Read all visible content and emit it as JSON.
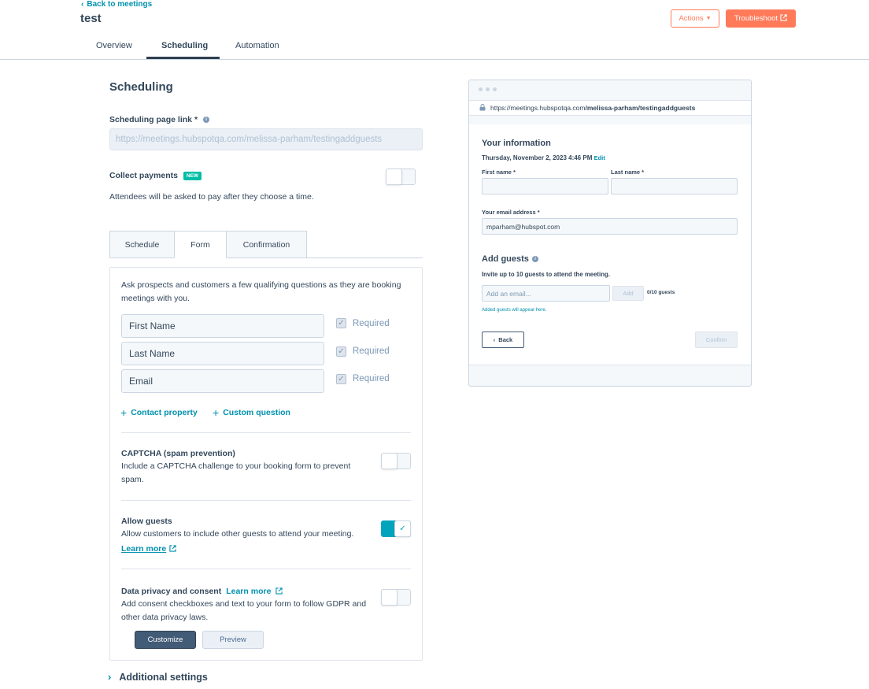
{
  "header": {
    "back_label": "Back to meetings",
    "title": "test",
    "actions_label": "Actions",
    "troubleshoot_label": "Troubleshoot",
    "tabs": [
      {
        "label": "Overview"
      },
      {
        "label": "Scheduling",
        "active": true
      },
      {
        "label": "Automation"
      }
    ]
  },
  "scheduling": {
    "title": "Scheduling",
    "page_link_label": "Scheduling page link",
    "required_marker": "*",
    "page_link_value": "https://meetings.hubspotqa.com/melissa-parham/testingaddguests",
    "collect_payments_label": "Collect payments",
    "new_badge": "NEW",
    "collect_payments_desc": "Attendees will be asked to pay after they choose a time.",
    "collect_payments_enabled": false
  },
  "inner_tabs": [
    {
      "label": "Schedule"
    },
    {
      "label": "Form",
      "active": true
    },
    {
      "label": "Confirmation"
    }
  ],
  "form": {
    "intro": "Ask prospects and customers a few qualifying questions as they are booking meetings with you.",
    "fields": [
      {
        "label": "First Name",
        "required_label": "Required",
        "required": true
      },
      {
        "label": "Last Name",
        "required_label": "Required",
        "required": true
      },
      {
        "label": "Email",
        "required_label": "Required",
        "required": true
      }
    ],
    "contact_property_label": "Contact property",
    "custom_question_label": "Custom question",
    "captcha": {
      "title": "CAPTCHA (spam prevention)",
      "desc": "Include a CAPTCHA challenge to your booking form to prevent spam.",
      "enabled": false
    },
    "guests": {
      "title": "Allow guests",
      "desc": "Allow customers to include other guests to attend your meeting.",
      "learn_more": "Learn more",
      "enabled": true
    },
    "privacy": {
      "title": "Data privacy and consent",
      "learn_more": "Learn more",
      "desc": "Add consent checkboxes and text to your form to follow GDPR and other data privacy laws.",
      "enabled": false,
      "customize_label": "Customize",
      "preview_label": "Preview"
    }
  },
  "additional_settings_label": "Additional settings",
  "preview": {
    "url_prefix": "https://meetings.hubspotqa.com",
    "url_path": "/melissa-parham/testingaddguests",
    "your_info_title": "Your information",
    "datetime": "Thursday, November 2, 2023 4:46 PM",
    "edit_label": "Edit",
    "first_name_label": "First name *",
    "last_name_label": "Last name *",
    "email_label": "Your email address *",
    "email_value": "mparham@hubspot.com",
    "add_guests_title": "Add guests",
    "invite_text": "Invite up to 10 guests to attend the meeting.",
    "add_email_placeholder": "Add an email...",
    "add_label": "Add",
    "guest_count": "0/10 guests",
    "added_note": "Added guests will appear here.",
    "back_label": "Back",
    "confirm_label": "Confirm"
  },
  "colors": {
    "accent": "#ff7a59",
    "link": "#0091ae",
    "toggle_on": "#00a4bd",
    "text": "#33475b"
  }
}
